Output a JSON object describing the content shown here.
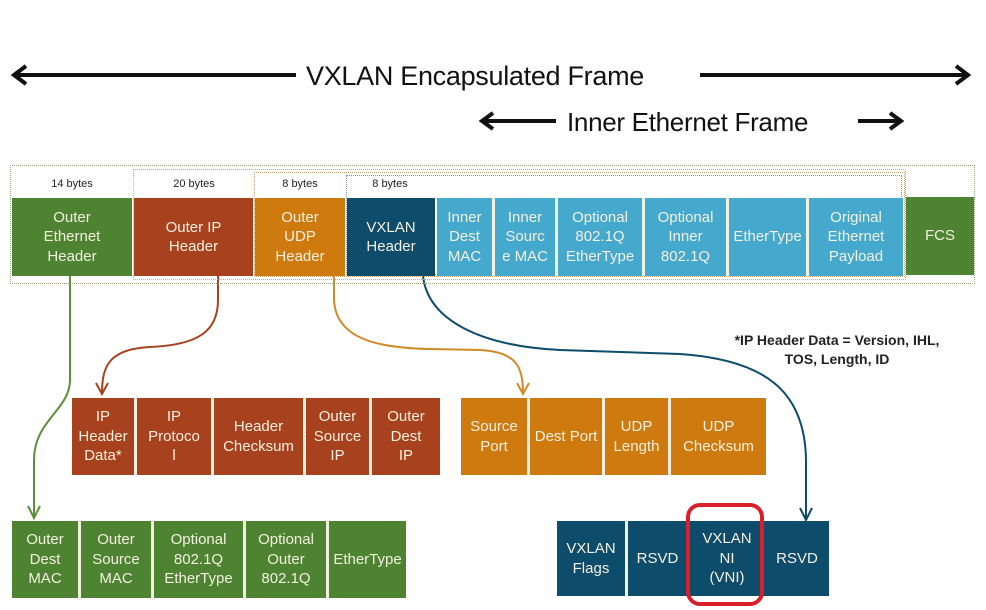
{
  "titles": {
    "outer_frame": "VXLAN Encapsulated Frame",
    "inner_frame": "Inner Ethernet Frame"
  },
  "frame": {
    "byte_labels": {
      "outer_ethernet": "14 bytes",
      "outer_ip": "20 bytes",
      "outer_udp": "8 bytes",
      "vxlan": "8 bytes"
    },
    "blocks": [
      {
        "id": "outer-ethernet-header",
        "label": "Outer\nEthernet\nHeader",
        "color": "#4e8431"
      },
      {
        "id": "outer-ip-header",
        "label": "Outer IP\nHeader",
        "color": "#a8411d"
      },
      {
        "id": "outer-udp-header",
        "label": "Outer\nUDP\nHeader",
        "color": "#cf7a0f"
      },
      {
        "id": "vxlan-header",
        "label": "VXLAN\nHeader",
        "color": "#0e4c6b"
      },
      {
        "id": "inner-dest-mac",
        "label": "Inner\nDest\nMAC",
        "color": "#45a9ce"
      },
      {
        "id": "inner-source-mac",
        "label": "Inner\nSourc\ne MAC",
        "color": "#45a9ce"
      },
      {
        "id": "optional-8021q-ethertype",
        "label": "Optional\n802.1Q\nEtherType",
        "color": "#45a9ce"
      },
      {
        "id": "optional-inner-8021q",
        "label": "Optional\nInner\n802.1Q",
        "color": "#45a9ce"
      },
      {
        "id": "inner-ethertype",
        "label": "EtherType",
        "color": "#45a9ce"
      },
      {
        "id": "original-ethernet-payload",
        "label": "Original\nEthernet\nPayload",
        "color": "#45a9ce"
      },
      {
        "id": "fcs",
        "label": "FCS",
        "color": "#4e8431"
      }
    ]
  },
  "ip_fields": [
    "IP\nHeader\nData*",
    "IP\nProtoco\nl",
    "Header\nChecksum",
    "Outer\nSource\nIP",
    "Outer\nDest\nIP"
  ],
  "udp_fields": [
    "Source\nPort",
    "Dest Port",
    "UDP\nLength",
    "UDP\nChecksum"
  ],
  "ethernet_fields": [
    "Outer\nDest\nMAC",
    "Outer\nSource\nMAC",
    "Optional\n802.1Q\nEtherType",
    "Optional\nOuter\n802.1Q",
    "EtherType"
  ],
  "vxlan_fields": [
    "VXLAN\nFlags",
    "RSVD",
    "VXLAN\nNI\n(VNI)",
    "RSVD"
  ],
  "highlighted_field": "VXLAN NI (VNI)",
  "footnote": "*IP Header Data = Version, IHL,\nTOS, Length, ID",
  "colors": {
    "ethernet": "#4e8431",
    "ip": "#a8411d",
    "udp": "#cf7a0f",
    "vxlan": "#0e4c6b",
    "inner": "#45a9ce",
    "highlight": "#d9202a"
  }
}
